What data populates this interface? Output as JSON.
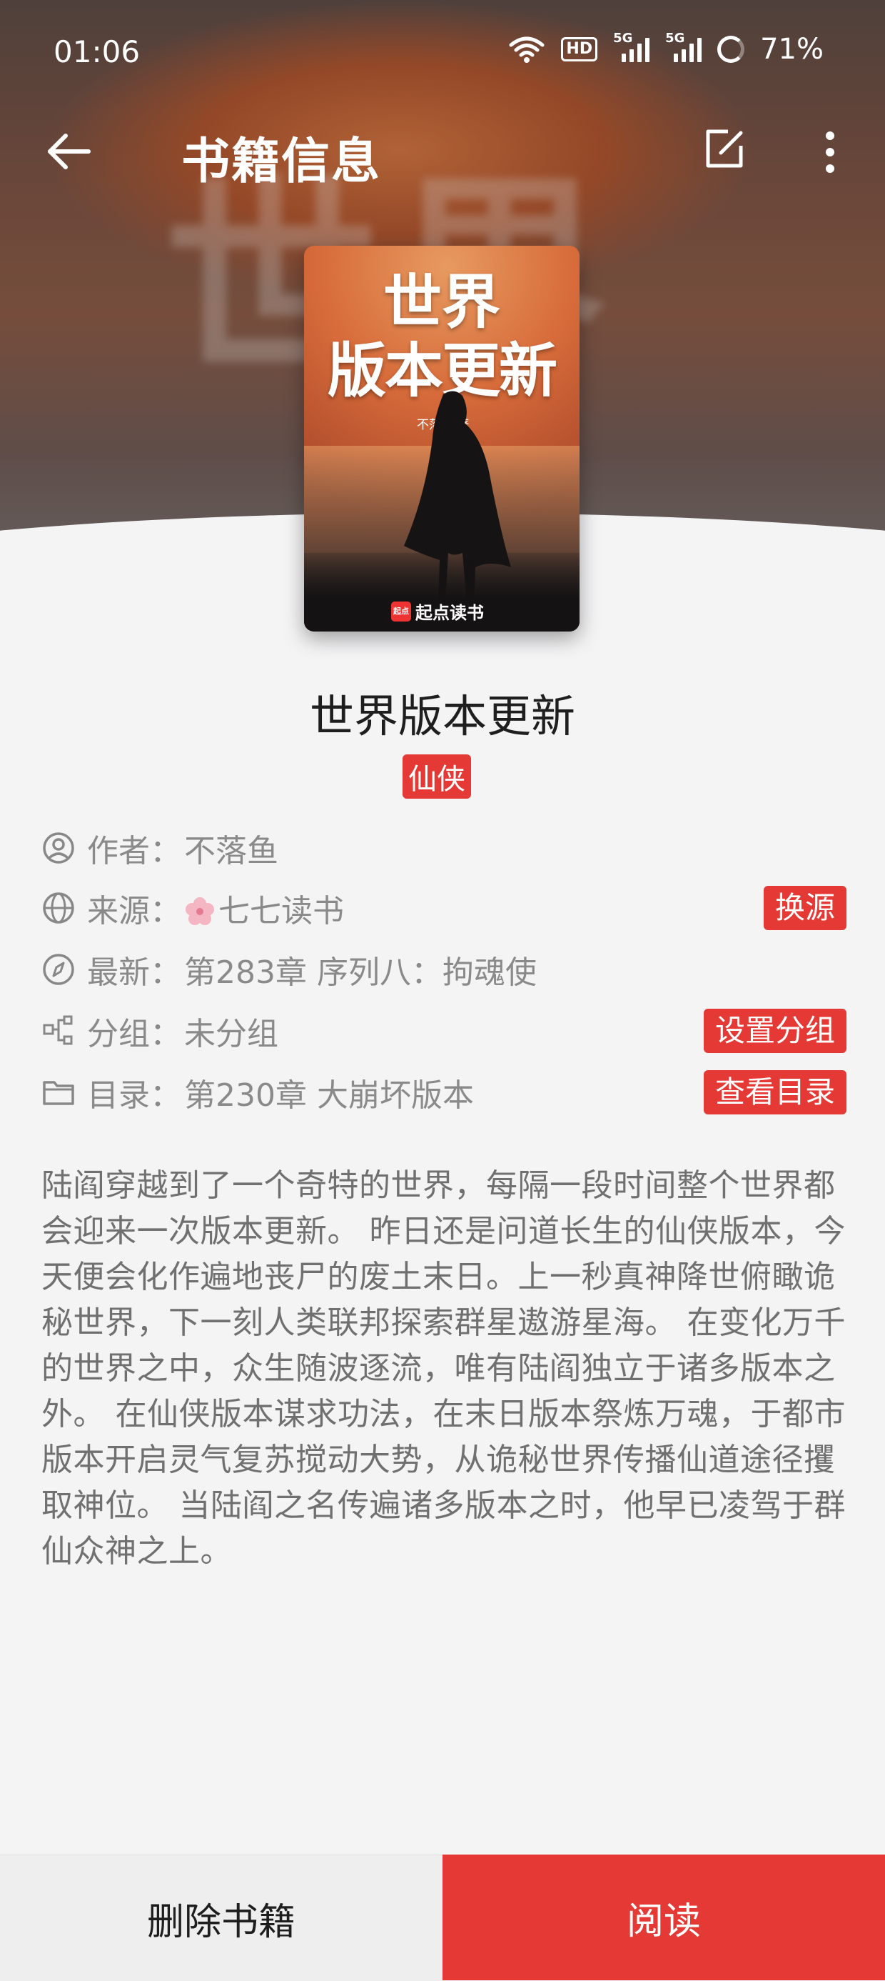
{
  "status_bar": {
    "time": "01:06",
    "hd_badge": "HD",
    "network_1": "5G",
    "network_2": "5G",
    "battery": "71%"
  },
  "toolbar": {
    "title": "书籍信息"
  },
  "cover": {
    "title_line1": "世界",
    "title_line2": "版本更新",
    "author": "不落鱼 著",
    "publisher_logo": "起点",
    "publisher": "起点读书"
  },
  "book": {
    "title": "世界版本更新",
    "genre": "仙侠",
    "rows": [
      {
        "label": "作者：",
        "value": "不落鱼"
      },
      {
        "label": "来源：",
        "value": "七七读书",
        "button": "换源"
      },
      {
        "label": "最新：",
        "value": "第283章 序列八：拘魂使"
      },
      {
        "label": "分组：",
        "value": "未分组",
        "button": "设置分组"
      },
      {
        "label": "目录：",
        "value": "第230章 大崩坏版本",
        "button": "查看目录"
      }
    ],
    "description": "陆阎穿越到了一个奇特的世界，每隔一段时间整个世界都会迎来一次版本更新。 昨日还是问道长生的仙侠版本，今天便会化作遍地丧尸的废土末日。上一秒真神降世俯瞰诡秘世界，下一刻人类联邦探索群星遨游星海。 在变化万千的世界之中，众生随波逐流，唯有陆阎独立于诸多版本之外。 在仙侠版本谋求功法，在末日版本祭炼万魂，于都市版本开启灵气复苏搅动大势，从诡秘世界传播仙道途径攫取神位。 当陆阎之名传遍诸多版本之时，他早已凌驾于群仙众神之上。"
  },
  "bottom": {
    "delete_label": "删除书籍",
    "read_label": "阅读"
  },
  "colors": {
    "accent": "#e53935",
    "background": "#f4f4f5"
  }
}
